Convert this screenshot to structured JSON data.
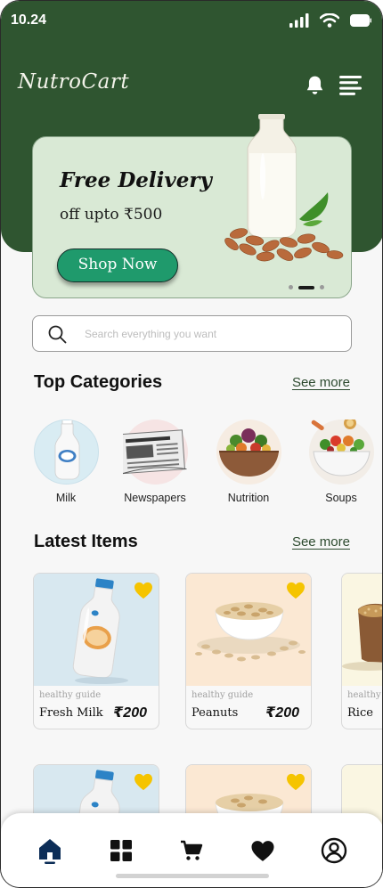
{
  "status_bar": {
    "time": "10.24"
  },
  "header": {
    "brand": "NutroCart"
  },
  "banner": {
    "title": "Free Delivery",
    "subtitle": "off upto ₹500",
    "cta_label": "Shop Now",
    "slide_count": 3,
    "active_slide": 2
  },
  "search": {
    "placeholder": "Search everything you want"
  },
  "top_categories": {
    "title": "Top Categories",
    "see_more": "See more",
    "items": [
      {
        "label": "Milk"
      },
      {
        "label": "Newspapers"
      },
      {
        "label": "Nutrition"
      },
      {
        "label": "Soups"
      }
    ]
  },
  "latest_items": {
    "title": "Latest Items",
    "see_more": "See more",
    "items": [
      {
        "meta": "healthy guide",
        "name": "Fresh Milk",
        "price": "₹200"
      },
      {
        "meta": "healthy guide",
        "name": "Peanuts",
        "price": "₹200"
      },
      {
        "meta": "healthy guide",
        "name": "Rice",
        "price": ""
      }
    ]
  },
  "bottom_nav": {
    "items": [
      {
        "icon": "home-icon",
        "active": true
      },
      {
        "icon": "grid-icon",
        "active": false
      },
      {
        "icon": "cart-icon",
        "active": false
      },
      {
        "icon": "heart-icon",
        "active": false
      },
      {
        "icon": "profile-icon",
        "active": false
      }
    ]
  },
  "colors": {
    "primary": "#2f5530",
    "banner_bg": "#d9e9d5",
    "cta": "#1f9a6c",
    "favorite": "#f5c400",
    "nav_active": "#0c2d57"
  }
}
